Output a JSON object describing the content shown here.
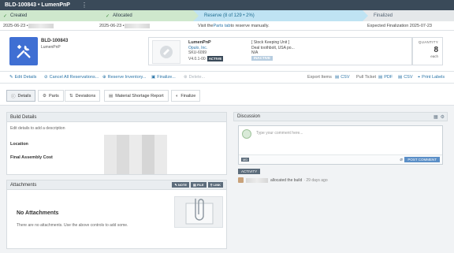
{
  "header": {
    "title": "BLD-100843 • LumenPnP",
    "kebab": "⋮"
  },
  "steps": [
    {
      "label": "Created",
      "check": "✓"
    },
    {
      "label": "Allocated",
      "check": "✓"
    },
    {
      "label": "Reserve (8 of 129 • 2%)"
    },
    {
      "label": "Finalized"
    }
  ],
  "dates": {
    "created": "2025-06-23 • ",
    "allocated": "2025-06-23 • ",
    "reserve_pre": "Visit the ",
    "reserve_link": "Parts tab",
    "reserve_post": " to reserve manually.",
    "finalized": "Expected Finalization 2025-07-23"
  },
  "build": {
    "number": "BLD-100843",
    "name": "LumenPnP"
  },
  "part": {
    "name": "LumenPnP",
    "company": "Opulo, Inc.",
    "sku": "SKU-6099",
    "version": "V4.0.1-00",
    "active_label": "ACTIVE",
    "desc_line1": "[ Stock Keeping Unit ]",
    "desc_line2": "Deal toothbolt, USA po...",
    "desc_line3": "N/A",
    "inactive_label": "INACTIVE"
  },
  "quantity": {
    "label": "QUANTITY",
    "value": "8",
    "unit": "each"
  },
  "actions": {
    "edit": "Edit Details",
    "cancel": "Cancel All Reservations...",
    "reserve": "Reserve Inventory...",
    "finalize": "Finalize...",
    "delete": "Delete...",
    "export": "Export Items",
    "csv": "CSV",
    "pull": "Pull Ticket",
    "pdf": "PDF",
    "csv2": "CSV",
    "labels": "Print Labels"
  },
  "tabs": [
    "Details",
    "Parts",
    "Deviations",
    "Material Shortage Report",
    "Finalize"
  ],
  "build_details": {
    "title": "Build Details",
    "edit_note": "Edit details to add a description",
    "location": "Location",
    "cost": "Final Assembly Cost"
  },
  "attachments": {
    "title": "Attachments",
    "buttons": [
      "NOTE",
      "FILE",
      "LINK"
    ],
    "empty_title": "No Attachments",
    "empty_sub": "There are no attachments. Use the above controls to add some."
  },
  "discussion": {
    "title": "Discussion",
    "placeholder": "Type your comment here...",
    "md": "MD",
    "post": "POST COMMENT",
    "activity_btn": "ACTIVITY",
    "activity_text": "allocated the build",
    "activity_time": "· 29 days ago"
  }
}
